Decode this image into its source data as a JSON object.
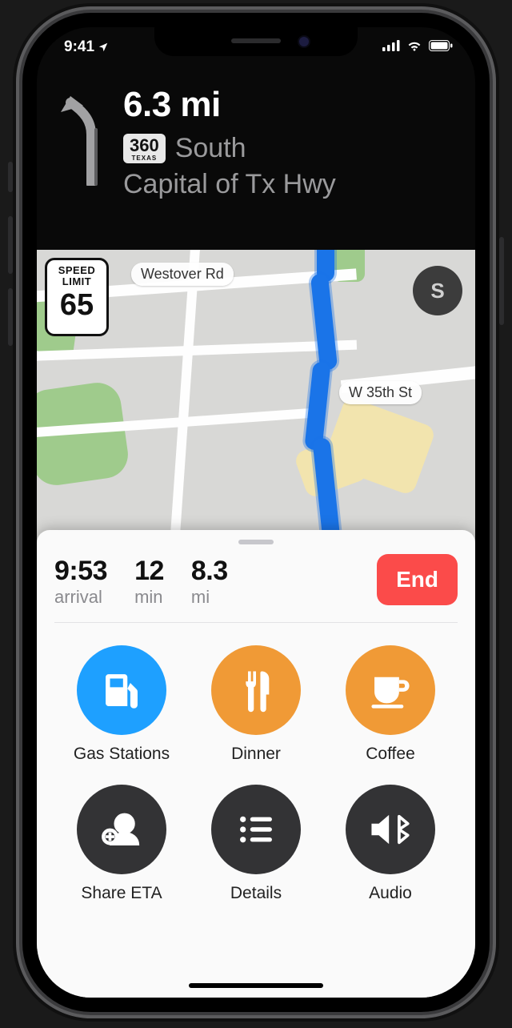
{
  "status": {
    "time": "9:41"
  },
  "banner": {
    "distance": "6.3 mi",
    "shield_num": "360",
    "shield_state": "TEXAS",
    "direction": "South",
    "road": "Capital of Tx Hwy"
  },
  "map": {
    "speed_limit_label": "SPEED LIMIT",
    "speed_limit_value": "65",
    "compass": "S",
    "labels": {
      "westover": "Westover Rd",
      "w35th": "W 35th St"
    }
  },
  "trip": {
    "arrival_value": "9:53",
    "arrival_label": "arrival",
    "duration_value": "12",
    "duration_label": "min",
    "distance_value": "8.3",
    "distance_label": "mi",
    "end_label": "End"
  },
  "actions": {
    "gas": "Gas Stations",
    "dinner": "Dinner",
    "coffee": "Coffee",
    "share": "Share ETA",
    "details": "Details",
    "audio": "Audio"
  }
}
